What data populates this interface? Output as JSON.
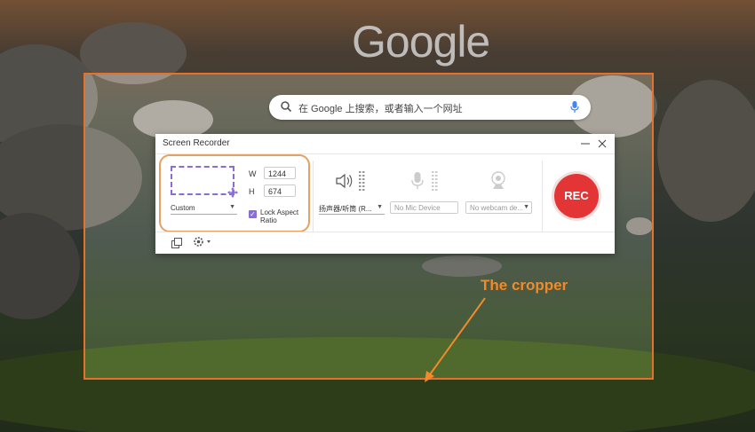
{
  "background": {
    "google_logo": "Google"
  },
  "search": {
    "placeholder": "在 Google 上搜索，或者输入一个网址"
  },
  "window": {
    "title": "Screen Recorder",
    "width_label": "W",
    "width_value": "1244",
    "height_label": "H",
    "height_value": "674",
    "size_preset": "Custom",
    "lock_ratio_label_1": "Lock Aspect",
    "lock_ratio_label_2": "Ratio",
    "lock_ratio_checked": true,
    "speaker_select": "扬声器/听筒 (R...",
    "mic_select": "No Mic Device",
    "webcam_select": "No webcam de...",
    "rec_label": "REC"
  },
  "annotation": {
    "text": "The cropper",
    "color": "#f08a2a"
  },
  "colors": {
    "crop_border": "#e8712a",
    "rec": "#e33535",
    "accent": "#8a6cd8"
  }
}
